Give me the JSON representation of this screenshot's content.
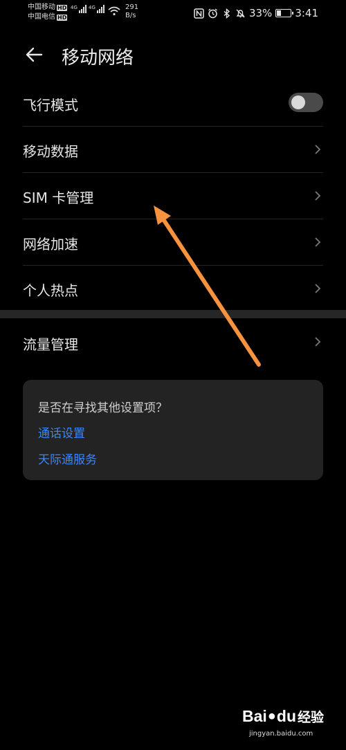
{
  "status_bar": {
    "carrier_1": "中国移动",
    "carrier_2": "中国电信",
    "hd_label": "HD",
    "net_type_1": "4G",
    "net_type_2": "4G",
    "net_speed_value": "291",
    "net_speed_unit": "B/s",
    "battery_percent": "33%",
    "battery_level": 0.33,
    "time": "3:41"
  },
  "header": {
    "title": "移动网络",
    "back_icon": "arrow-left-icon"
  },
  "settings": [
    {
      "label": "飞行模式",
      "control": "toggle",
      "on": false
    },
    {
      "label": "移动数据",
      "control": "chevron"
    },
    {
      "label": "SIM 卡管理",
      "control": "chevron"
    },
    {
      "label": "网络加速",
      "control": "chevron"
    },
    {
      "label": "个人热点",
      "control": "chevron"
    }
  ],
  "traffic": {
    "label": "流量管理"
  },
  "suggestions": {
    "question": "是否在寻找其他设置项？",
    "links": [
      "通话设置",
      "天际通服务"
    ]
  },
  "colors": {
    "background": "#000000",
    "link": "#3f86f0",
    "annotation_arrow": "#f7923f",
    "card_background": "#232323"
  },
  "watermark": {
    "brand_1": "Bai",
    "brand_2": "du",
    "brand_3": "经验",
    "url": "jingyan.baidu.com"
  }
}
